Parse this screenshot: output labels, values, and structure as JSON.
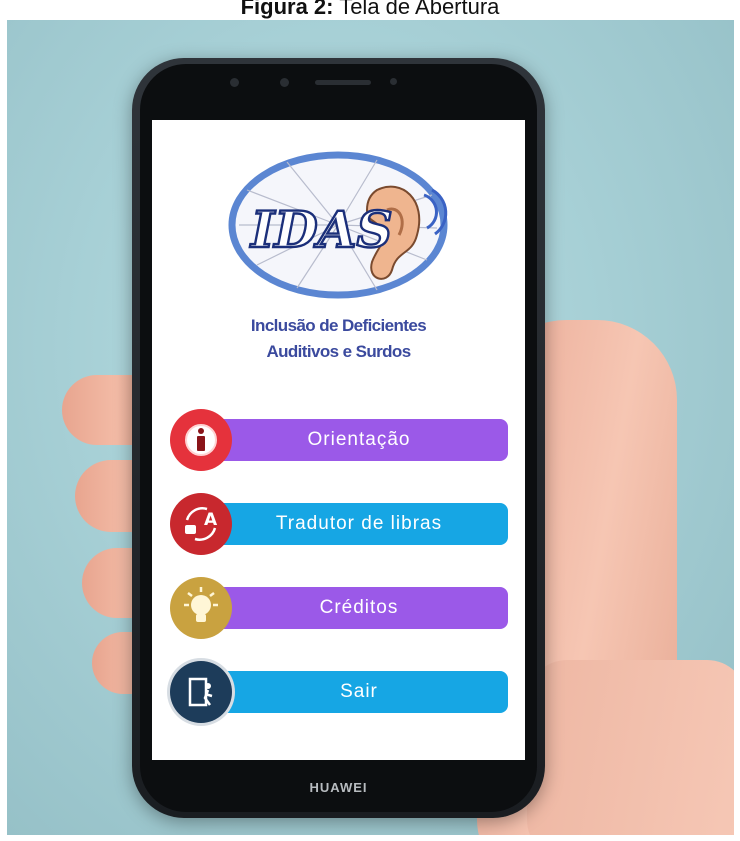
{
  "caption": {
    "bold": "Figura 2:",
    "rest": " Tela de Abertura"
  },
  "phone": {
    "brand": "HUAWEI"
  },
  "app": {
    "logo_text": "IDAS",
    "subtitle_line1": "Inclusão de Deficientes",
    "subtitle_line2": "Auditivos e Surdos"
  },
  "menu": [
    {
      "label": "Orientação",
      "icon": "info-icon",
      "bar_color": "#9b59e8",
      "icon_color": "#e5323c"
    },
    {
      "label": "Tradutor de libras",
      "icon": "translate-icon",
      "bar_color": "#16a6e4",
      "icon_color": "#c8282e"
    },
    {
      "label": "Créditos",
      "icon": "lightbulb-icon",
      "bar_color": "#9b59e8",
      "icon_color": "#c9a240"
    },
    {
      "label": "Sair",
      "icon": "exit-door-icon",
      "bar_color": "#16a6e4",
      "icon_color": "#1d3c5a"
    }
  ]
}
